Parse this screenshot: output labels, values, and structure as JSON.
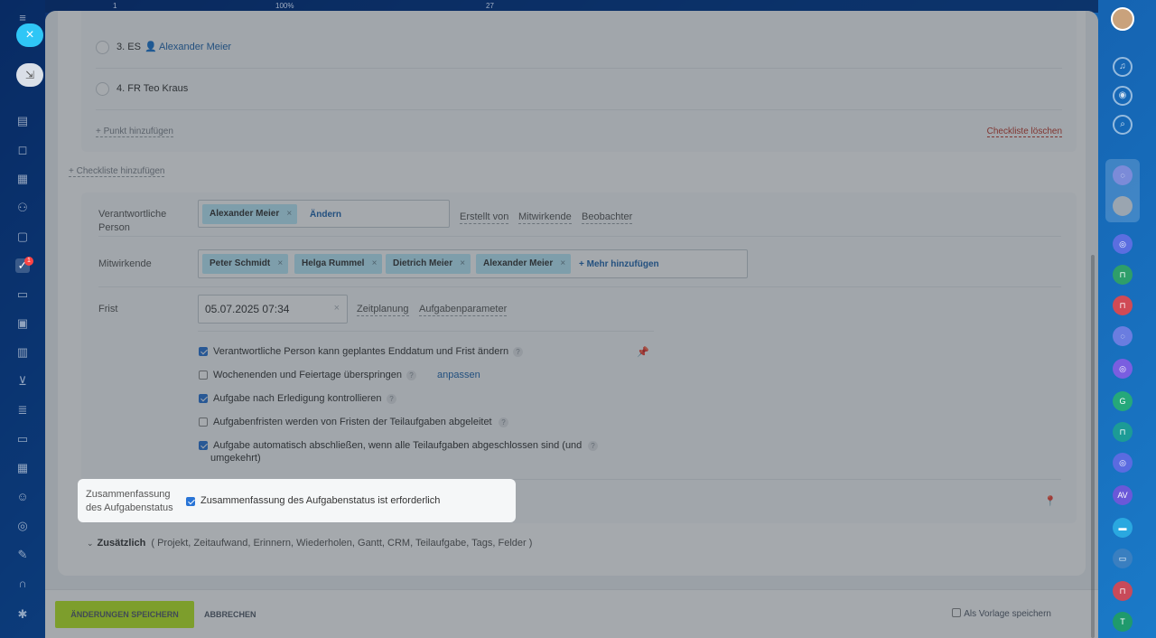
{
  "background": {
    "top_counters": [
      "1",
      "100%",
      "27"
    ]
  },
  "left_nav": {
    "close_label": "×",
    "collapse_label": "⇲",
    "badge": "1"
  },
  "checklist": {
    "items": [
      {
        "number": "3.",
        "text": "ES",
        "user": "Alexander Meier"
      },
      {
        "number": "4.",
        "text": "FR Teo Kraus"
      }
    ],
    "add_point": "+ Punkt hinzufügen",
    "delete": "Checkliste löschen",
    "add_checklist": "+ Checkliste hinzufügen"
  },
  "responsible": {
    "label": "Verantwortliche Person",
    "tag": "Alexander Meier",
    "change": "Ändern",
    "links": [
      "Erstellt von",
      "Mitwirkende",
      "Beobachter"
    ]
  },
  "participants": {
    "label": "Mitwirkende",
    "tags": [
      "Peter Schmidt",
      "Helga Rummel",
      "Dietrich Meier",
      "Alexander Meier"
    ],
    "add_more": "+ Mehr hinzufügen"
  },
  "deadline": {
    "label": "Frist",
    "value": "05.07.2025 07:34",
    "links": [
      "Zeitplanung",
      "Aufgabenparameter"
    ]
  },
  "options": [
    {
      "text": "Verantwortliche Person kann geplantes Enddatum und Frist ändern",
      "checked": true
    },
    {
      "text": "Wochenenden und Feiertage überspringen",
      "checked": false,
      "extra": "anpassen"
    },
    {
      "text": "Aufgabe nach Erledigung kontrollieren",
      "checked": true
    },
    {
      "text": "Aufgabenfristen werden von Fristen der Teilaufgaben abgeleitet",
      "checked": false
    },
    {
      "text": "Aufgabe automatisch abschließen, wenn alle Teilaufgaben abgeschlossen sind (und",
      "text2": "umgekehrt)",
      "checked": true
    }
  ],
  "summary": {
    "label_line1": "Zusammenfassung",
    "label_line2": "des Aufgabenstatus",
    "checkbox_text": "Zusammenfassung des Aufgabenstatus ist erforderlich",
    "checked": true
  },
  "additional": {
    "title": "Zusätzlich",
    "items": "( Projekt,  Zeitaufwand,  Erinnern,  Wiederholen,  Gantt,  CRM,  Teilaufgabe,  Tags,  Felder )"
  },
  "footer": {
    "save": "ÄNDERUNGEN SPEICHERN",
    "cancel": "ABBRECHEN",
    "template": "Als Vorlage speichern"
  },
  "right_strip": {
    "dots": [
      "G",
      "AV",
      "T"
    ]
  },
  "colors": {
    "accent_blue": "#2067b0",
    "tag_bg": "#bcedfc",
    "save_green": "#bbed21",
    "delete_red": "#c0392b",
    "close_cyan": "#2fc6f6"
  }
}
